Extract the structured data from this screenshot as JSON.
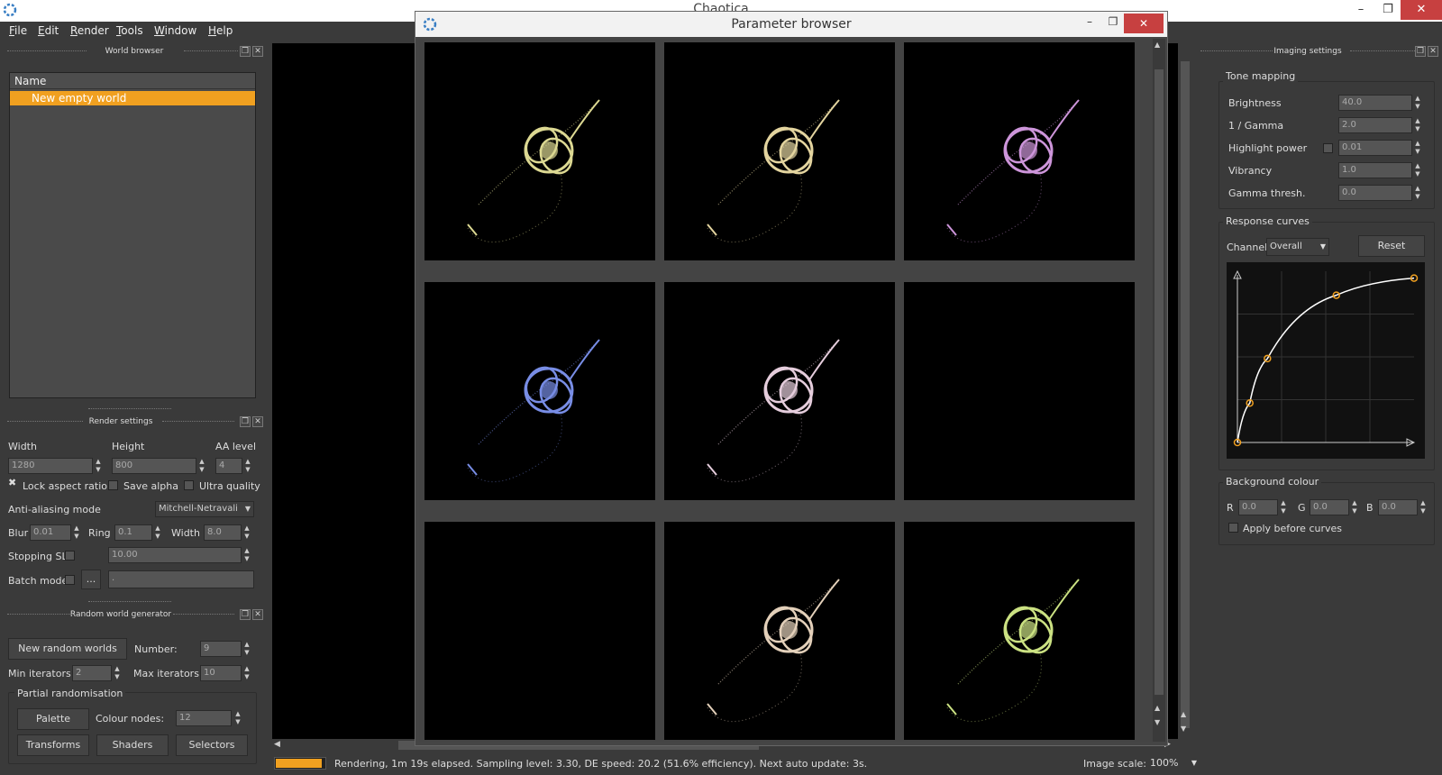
{
  "app": {
    "title": "Chaotica"
  },
  "window_controls": {
    "minimize": "–",
    "maximize": "❐",
    "close": "✕"
  },
  "menu": [
    {
      "key": "F",
      "rest": "ile"
    },
    {
      "key": "E",
      "rest": "dit"
    },
    {
      "key": "R",
      "rest": "ender"
    },
    {
      "key": "T",
      "rest": "ools"
    },
    {
      "key": "W",
      "rest": "indow"
    },
    {
      "key": "H",
      "rest": "elp"
    }
  ],
  "world_browser": {
    "title": "World browser",
    "column": "Name",
    "items": [
      "New empty world"
    ]
  },
  "render_settings": {
    "title": "Render settings",
    "width_label": "Width",
    "width": "1280",
    "height_label": "Height",
    "height": "800",
    "aa_label": "AA level",
    "aa": "4",
    "lock_aspect": "Lock aspect ratio",
    "save_alpha": "Save alpha",
    "ultra_quality": "Ultra quality",
    "aa_mode_label": "Anti-aliasing mode",
    "aa_mode": "Mitchell-Netravali",
    "blur_label": "Blur",
    "blur": "0.01",
    "ring_label": "Ring",
    "ring": "0.1",
    "rwidth_label": "Width",
    "rwidth": "8.0",
    "stopping_label": "Stopping SL",
    "stopping": "10.00",
    "batch_label": "Batch mode",
    "batch_btn": "...",
    "batch_path": "."
  },
  "random_gen": {
    "title": "Random world generator",
    "new_btn": "New random worlds",
    "number_label": "Number:",
    "number": "9",
    "min_label": "Min iterators:",
    "min": "2",
    "max_label": "Max iterators:",
    "max": "10",
    "partial_title": "Partial randomisation",
    "palette_btn": "Palette",
    "colour_nodes_label": "Colour nodes:",
    "colour_nodes": "12",
    "transforms_btn": "Transforms",
    "shaders_btn": "Shaders",
    "selectors_btn": "Selectors"
  },
  "param_browser": {
    "title": "Parameter browser",
    "thumbs": [
      {
        "color": "#e8e49a",
        "empty": false
      },
      {
        "color": "#f0e0a8",
        "empty": false
      },
      {
        "color": "#d99ee6",
        "empty": false
      },
      {
        "color": "#7f95f2",
        "empty": false
      },
      {
        "color": "#f2d8e8",
        "empty": false
      },
      {
        "color": "#000000",
        "empty": true
      },
      {
        "color": "#000000",
        "empty": true
      },
      {
        "color": "#f0dcc4",
        "empty": false
      },
      {
        "color": "#d6ee8a",
        "empty": false
      }
    ]
  },
  "imaging": {
    "title": "Imaging settings",
    "tone_title": "Tone mapping",
    "rows": [
      {
        "label": "Brightness",
        "value": "40.0"
      },
      {
        "label": "1 / Gamma",
        "value": "2.0"
      },
      {
        "label": "Highlight power",
        "value": "0.01"
      },
      {
        "label": "Vibrancy",
        "value": "1.0"
      },
      {
        "label": "Gamma thresh.",
        "value": "0.0"
      }
    ],
    "curves_title": "Response curves",
    "channel_label": "Channel:",
    "channel": "Overall",
    "reset_btn": "Reset",
    "bg_title": "Background colour",
    "r_label": "R",
    "r": "0.0",
    "g_label": "G",
    "g": "0.0",
    "b_label": "B",
    "b": "0.0",
    "apply_before": "Apply before curves",
    "curve_points": [
      [
        0,
        0
      ],
      [
        0.07,
        0.23
      ],
      [
        0.17,
        0.49
      ],
      [
        0.56,
        0.86
      ],
      [
        1,
        0.96
      ]
    ]
  },
  "status": {
    "text": "Rendering, 1m 19s elapsed. Sampling level: 3.30, DE speed: 20.2 (51.6% efficiency). Next auto update: 3s.",
    "progress": 0.95,
    "scale_label": "Image scale:",
    "scale": "100%"
  },
  "colors": {
    "accent": "#f0a020",
    "selection": "#f0a020"
  }
}
